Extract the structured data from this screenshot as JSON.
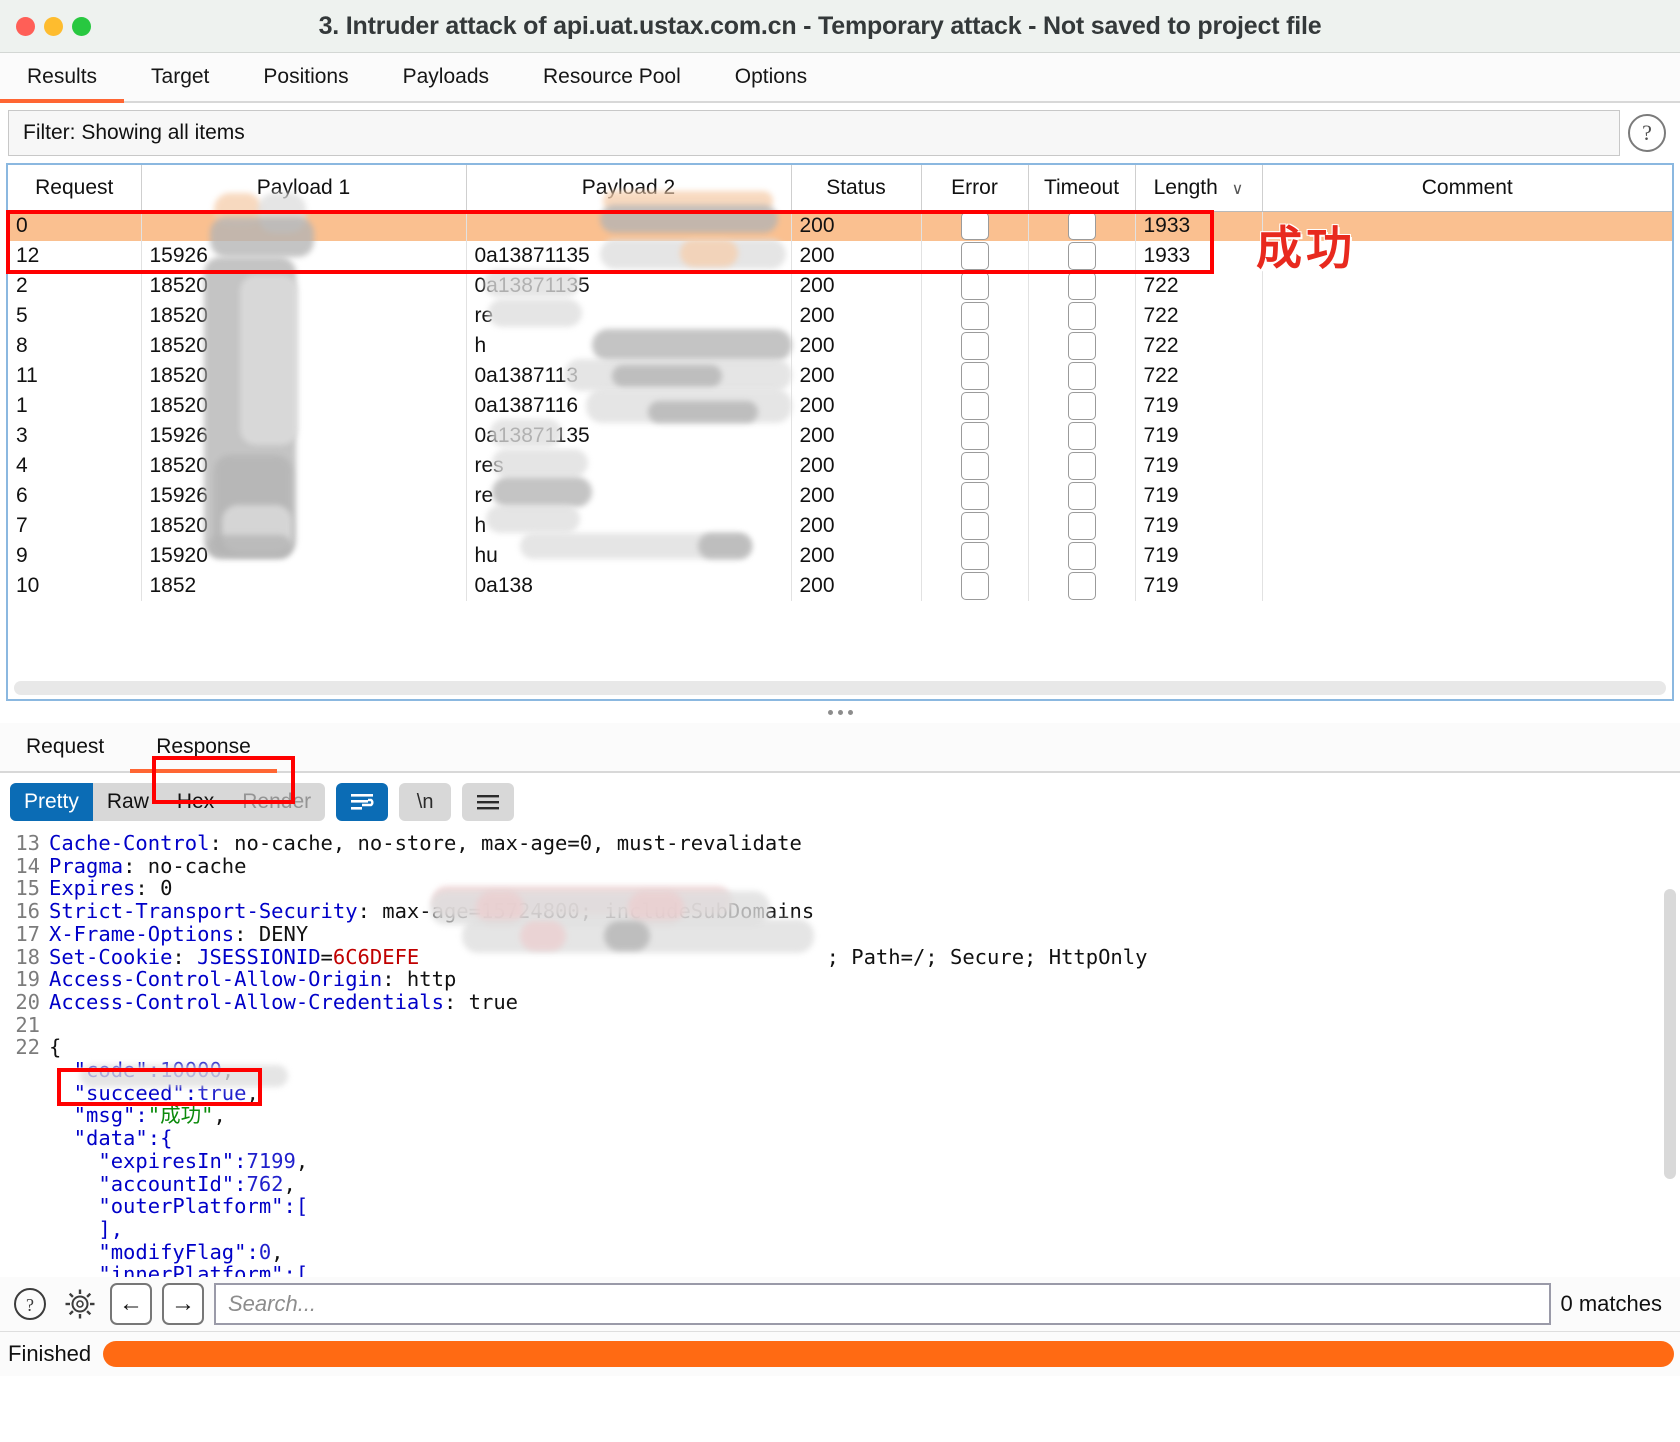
{
  "window": {
    "title": "3. Intruder attack of api.uat.ustax.com.cn - Temporary attack - Not saved to project file",
    "traffic_lights": [
      "close",
      "minimize",
      "maximize"
    ]
  },
  "top_tabs": [
    {
      "label": "Results",
      "active": true
    },
    {
      "label": "Target",
      "active": false
    },
    {
      "label": "Positions",
      "active": false
    },
    {
      "label": "Payloads",
      "active": false
    },
    {
      "label": "Resource Pool",
      "active": false
    },
    {
      "label": "Options",
      "active": false
    }
  ],
  "filter": {
    "text": "Filter: Showing all items",
    "help_glyph": "?"
  },
  "results_table": {
    "columns": [
      "Request",
      "Payload 1",
      "Payload 2",
      "Status",
      "Error",
      "Timeout",
      "Length",
      "Comment"
    ],
    "sorted_column": "Length",
    "sort_caret": "∨",
    "rows": [
      {
        "request": "0",
        "payload1": "",
        "payload2": "",
        "status": "200",
        "error": false,
        "timeout": false,
        "length": "1933",
        "comment": "",
        "highlight": true
      },
      {
        "request": "12",
        "payload1": "15926",
        "payload2": "0a13871135",
        "status": "200",
        "error": false,
        "timeout": false,
        "length": "1933",
        "comment": "",
        "highlight": false
      },
      {
        "request": "2",
        "payload1": "18520",
        "payload2": "0a13871135",
        "status": "200",
        "error": false,
        "timeout": false,
        "length": "722",
        "comment": "",
        "highlight": false
      },
      {
        "request": "5",
        "payload1": "18520",
        "payload2": "re",
        "status": "200",
        "error": false,
        "timeout": false,
        "length": "722",
        "comment": "",
        "highlight": false
      },
      {
        "request": "8",
        "payload1": "18520",
        "payload2": "h",
        "status": "200",
        "error": false,
        "timeout": false,
        "length": "722",
        "comment": "",
        "highlight": false
      },
      {
        "request": "11",
        "payload1": "18520",
        "payload2": "0a1387113",
        "status": "200",
        "error": false,
        "timeout": false,
        "length": "722",
        "comment": "",
        "highlight": false
      },
      {
        "request": "1",
        "payload1": "18520",
        "payload2": "0a1387116",
        "status": "200",
        "error": false,
        "timeout": false,
        "length": "719",
        "comment": "",
        "highlight": false
      },
      {
        "request": "3",
        "payload1": "15926",
        "payload2": "0a13871135",
        "status": "200",
        "error": false,
        "timeout": false,
        "length": "719",
        "comment": "",
        "highlight": false
      },
      {
        "request": "4",
        "payload1": "18520",
        "payload2": "res",
        "status": "200",
        "error": false,
        "timeout": false,
        "length": "719",
        "comment": "",
        "highlight": false
      },
      {
        "request": "6",
        "payload1": "15926",
        "payload2": "re",
        "status": "200",
        "error": false,
        "timeout": false,
        "length": "719",
        "comment": "",
        "highlight": false
      },
      {
        "request": "7",
        "payload1": "18520",
        "payload2": "h",
        "status": "200",
        "error": false,
        "timeout": false,
        "length": "719",
        "comment": "",
        "highlight": false
      },
      {
        "request": "9",
        "payload1": "15920",
        "payload2": "hu",
        "status": "200",
        "error": false,
        "timeout": false,
        "length": "719",
        "comment": "",
        "highlight": false
      },
      {
        "request": "10",
        "payload1": "1852",
        "payload2": "0a138",
        "status": "200",
        "error": false,
        "timeout": false,
        "length": "719",
        "comment": "",
        "highlight": false
      }
    ]
  },
  "annotations": {
    "table_success_label": "成功",
    "msg_success_value": "成功"
  },
  "message_tabs": [
    {
      "label": "Request",
      "active": false
    },
    {
      "label": "Response",
      "active": true
    }
  ],
  "editor_toolbar": {
    "segments": [
      {
        "label": "Pretty",
        "active": true,
        "disabled": false
      },
      {
        "label": "Raw",
        "active": false,
        "disabled": false
      },
      {
        "label": "Hex",
        "active": false,
        "disabled": false
      },
      {
        "label": "Render",
        "active": false,
        "disabled": true
      }
    ],
    "wrap_icon": "word-wrap-icon",
    "newline_label": "\\n",
    "menu_icon": "hamburger-icon"
  },
  "response_lines": [
    {
      "no": "13",
      "segments": [
        {
          "t": "Cache-Control",
          "c": "k-hdr"
        },
        {
          "t": ": no-cache, no-store, max-age=0, must-revalidate",
          "c": "ctext"
        }
      ]
    },
    {
      "no": "14",
      "segments": [
        {
          "t": "Pragma",
          "c": "k-hdr"
        },
        {
          "t": ": no-cache",
          "c": "ctext"
        }
      ]
    },
    {
      "no": "15",
      "segments": [
        {
          "t": "Expires",
          "c": "k-hdr"
        },
        {
          "t": ": 0",
          "c": "ctext"
        }
      ]
    },
    {
      "no": "16",
      "segments": [
        {
          "t": "Strict-Transport-Security",
          "c": "k-hdr"
        },
        {
          "t": ": max-age=15724800; includeSubDomains",
          "c": "ctext"
        }
      ]
    },
    {
      "no": "17",
      "segments": [
        {
          "t": "X-Frame-Options",
          "c": "k-hdr"
        },
        {
          "t": ": DENY",
          "c": "ctext"
        }
      ]
    },
    {
      "no": "18",
      "segments": [
        {
          "t": "Set-Cookie",
          "c": "k-hdr"
        },
        {
          "t": ": ",
          "c": "ctext"
        },
        {
          "t": "JSESSIONID",
          "c": "k-str"
        },
        {
          "t": "=",
          "c": "ctext"
        },
        {
          "t": "6C6DEFE",
          "c": "k-red"
        },
        {
          "t": "                                 ; Path=/; Secure; HttpOnly",
          "c": "ctext"
        }
      ]
    },
    {
      "no": "19",
      "segments": [
        {
          "t": "Access-Control-Allow-Origin",
          "c": "k-hdr"
        },
        {
          "t": ": http",
          "c": "ctext"
        }
      ]
    },
    {
      "no": "20",
      "segments": [
        {
          "t": "Access-Control-Allow-Credentials",
          "c": "k-hdr"
        },
        {
          "t": ": true",
          "c": "ctext"
        }
      ]
    },
    {
      "no": "21",
      "segments": [
        {
          "t": "",
          "c": "ctext"
        }
      ]
    },
    {
      "no": "22",
      "segments": [
        {
          "t": "{",
          "c": "ctext"
        }
      ]
    },
    {
      "no": "",
      "segments": [
        {
          "t": "  \"code\":",
          "c": "k-str"
        },
        {
          "t": "10000",
          "c": "k-num"
        },
        {
          "t": ",",
          "c": "ctext"
        }
      ]
    },
    {
      "no": "",
      "segments": [
        {
          "t": "  \"succeed\":",
          "c": "k-str"
        },
        {
          "t": "true",
          "c": "k-num"
        },
        {
          "t": ",",
          "c": "ctext"
        }
      ]
    },
    {
      "no": "",
      "segments": [
        {
          "t": "  \"msg\":",
          "c": "k-str"
        },
        {
          "t": "\"成功\"",
          "c": "k-green"
        },
        {
          "t": ",",
          "c": "ctext"
        }
      ]
    },
    {
      "no": "",
      "segments": [
        {
          "t": "  \"data\":{",
          "c": "k-str"
        }
      ]
    },
    {
      "no": "",
      "segments": [
        {
          "t": "    \"expiresIn\":",
          "c": "k-str"
        },
        {
          "t": "7199",
          "c": "k-num"
        },
        {
          "t": ",",
          "c": "ctext"
        }
      ]
    },
    {
      "no": "",
      "segments": [
        {
          "t": "    \"accountId\":",
          "c": "k-str"
        },
        {
          "t": "762",
          "c": "k-num"
        },
        {
          "t": ",",
          "c": "ctext"
        }
      ]
    },
    {
      "no": "",
      "segments": [
        {
          "t": "    \"outerPlatform\":[",
          "c": "k-str"
        }
      ]
    },
    {
      "no": "",
      "segments": [
        {
          "t": "    ],",
          "c": "k-str"
        }
      ]
    },
    {
      "no": "",
      "segments": [
        {
          "t": "    \"modifyFlag\":",
          "c": "k-str"
        },
        {
          "t": "0",
          "c": "k-num"
        },
        {
          "t": ",",
          "c": "ctext"
        }
      ]
    },
    {
      "no": "",
      "segments": [
        {
          "t": "    \"innerPlatform\":[",
          "c": "k-str"
        }
      ]
    }
  ],
  "search": {
    "placeholder": "Search...",
    "value": "",
    "matches_label": "0 matches",
    "help_glyph": "?",
    "gear_glyph": "⚙",
    "prev_glyph": "←",
    "next_glyph": "→"
  },
  "status": {
    "text": "Finished",
    "progress_percent": 100,
    "progress_color": "#ff6a13"
  }
}
